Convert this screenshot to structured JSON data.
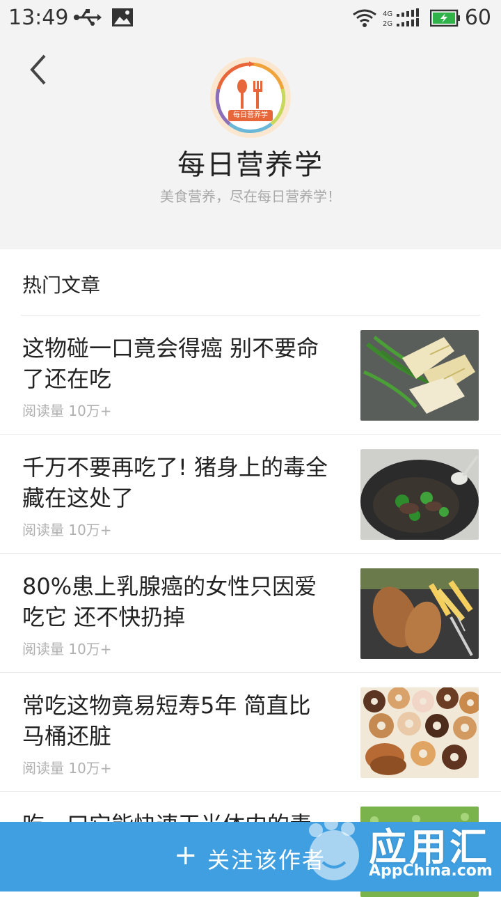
{
  "status_bar": {
    "time": "13:49",
    "battery": "60",
    "network_labels": [
      "4G",
      "2G"
    ]
  },
  "header": {
    "logo_text": "每日营养学",
    "title": "每日营养学",
    "subtitle": "美食营养，尽在每日营养学！"
  },
  "section": {
    "title": "热门文章"
  },
  "articles": [
    {
      "title": "这物碰一口竟会得癌 别不要命了还在吃",
      "meta": "阅读量 10万+",
      "thumb": "bamboo-shoots-image"
    },
    {
      "title": "千万不要再吃了! 猪身上的毒全藏在这处了",
      "meta": "阅读量 10万+",
      "thumb": "wok-stirfry-image"
    },
    {
      "title": "80%患上乳腺癌的女性只因爱吃它 还不快扔掉",
      "meta": "阅读量 10万+",
      "thumb": "fried-food-image"
    },
    {
      "title": "常吃这物竟易短寿5年 简直比马桶还脏",
      "meta": "阅读量 10万+",
      "thumb": "donuts-image"
    },
    {
      "title": "吃一口它能快速干光体内的毒",
      "meta": "",
      "thumb": "bitter-melon-image"
    }
  ],
  "follow_bar": {
    "icon": "plus-icon",
    "label": "关注该作者"
  },
  "watermark": {
    "brand": "应用汇",
    "domain": "AppChina.com"
  },
  "colors": {
    "follow_bar": "#3f9fe0",
    "header_bg": "#f3f3f3",
    "logo_orange": "#e8673a",
    "battery_green": "#2fb24a"
  }
}
